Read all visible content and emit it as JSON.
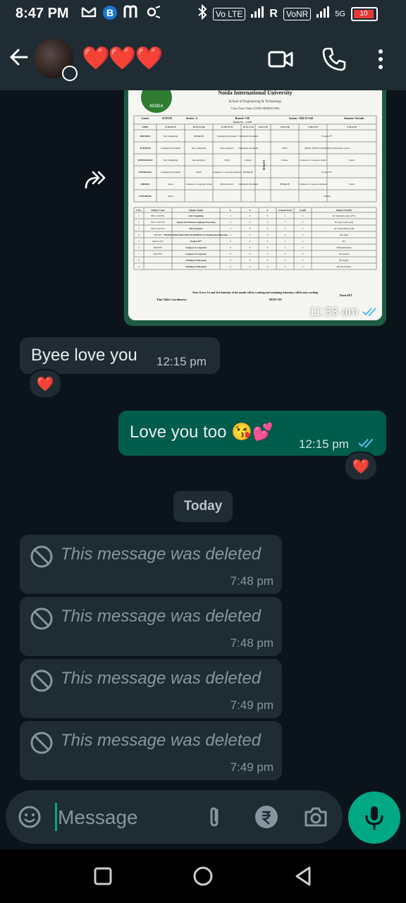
{
  "status_bar": {
    "time": "8:47 PM",
    "left_icons": [
      "gmail-icon",
      "b-icon",
      "m-icon",
      "settings-icon"
    ],
    "volte_label": "Vo LTE",
    "signal1_label": "R",
    "vonr_label": "VoNR",
    "network_label": "5G",
    "battery_label": "10"
  },
  "header": {
    "contact_name": "❤️❤️❤️"
  },
  "chat": {
    "image_message": {
      "time": "11:33 am",
      "document": {
        "university": "Noida International University",
        "school": "School of Engineering & Technology",
        "subtitle": "Class Time Table (ODD SEMESTER)",
        "course": "Course",
        "btech": "B.TECH",
        "section": "Section : A",
        "branch": "Branch: CSE",
        "session": "Session : 2024-25 Odd",
        "semester": "Semester: Seventh",
        "room": "Room No. - N-105",
        "times": [
          "TIME",
          "9:30-10:25",
          "10:25-11:20",
          "11:20-12:15",
          "12:15-1:10",
          "1:10-1:45",
          "1:45-2:40",
          "2:40-3:35",
          "3:35-4:30"
        ],
        "days": [
          {
            "day": "MONDAY",
            "c1": "Soft Computing",
            "c2": "HRD&OB",
            "c3": "Training & Placement",
            "c4": "Training & Placement",
            "c5": "",
            "c6": "Project-II**"
          },
          {
            "day": "TUESDAY",
            "c1": "Training & Placement",
            "c2": "Soft Computing",
            "c3": "Data Analytics",
            "c4": "Training & Placement",
            "c5": "SNLP",
            "c6": "MOOC (NPTEL/SWAYAM) Certification Course"
          },
          {
            "day": "WEDNESDAY",
            "c1": "Soft Computing",
            "c2": "Data Analytics",
            "c3": "SNLP",
            "c4": "Library",
            "c5": "Library",
            "c6": "Compass to Corporate Verbal",
            "c7": "Sports"
          },
          {
            "day": "THURSDAY",
            "c1": "Training & Placement",
            "c2": "SNLP",
            "c3": "Compass to Corporate Aptitude",
            "c4": "HRD&OB",
            "c5": "",
            "c6": "Project-II**"
          },
          {
            "day": "FRIDAY",
            "c1": "Sports",
            "c2": "Compass to Corporate Verbal",
            "c3": "Data Analytics",
            "c4": "Training & Placement",
            "c5": "HRD&OB",
            "c6": "Compass to Corporate Aptitude",
            "c7": "Sports"
          },
          {
            "day": "SATURDAY",
            "c1": "Sports",
            "c6": "Library"
          }
        ],
        "lunch": "LUNCH",
        "subject_headers": [
          "S.No.",
          "Subject Code",
          "Subject Name",
          "L",
          "T",
          "P",
          "Contact hour",
          "Credit",
          "Subject Faculty"
        ],
        "subjects": [
          [
            "1",
            "PEC-CS-D 701",
            "Soft Computing",
            "3",
            "0",
            "0",
            "3",
            "3",
            "Dr. Veerendra yadav (VY)"
          ],
          [
            "2",
            "PEC-CS-D 702",
            "Speech and Natural Language Processing",
            "3",
            "0",
            "0",
            "3",
            "3",
            "Dr. Arpit Tomar (AT)"
          ],
          [
            "3",
            "PEC-CS-D 703",
            "Data Analytics",
            "3",
            "0",
            "0",
            "3",
            "3",
            "Dr. Vimal Bibhu (VB)"
          ],
          [
            "4",
            "OEC002",
            "HUMAN RESOURCE DEVELOPMENT & Organization Behaviour",
            "3",
            "0",
            "0",
            "3",
            "3",
            "Mr. Abhu"
          ],
          [
            "5",
            "PROJ-CS70",
            "Project-II**",
            "0",
            "0",
            "0",
            "3",
            "3",
            "SF1"
          ],
          [
            "6",
            "NIUTP07",
            "Compass to Corporate",
            "0",
            "0",
            "0",
            "3",
            "3",
            "Vibha Khurendra"
          ],
          [
            "7",
            "NIUTP07",
            "Compass to Corporate",
            "0",
            "0",
            "0",
            "3",
            "3",
            "Varu Kumar"
          ],
          [
            "8",
            "",
            "Training & Placement",
            "0",
            "0",
            "0",
            "3",
            "3",
            "Mr Pragya"
          ],
          [
            "9",
            "",
            "Training & Placement",
            "0",
            "0",
            "0",
            "3",
            "3",
            "Mr Pawan Dutta"
          ]
        ],
        "note": "Note: Every 1st and 3rd Saturday of the month will be working and remaining Saturdays will be non-working",
        "coordinator": "Time Table Coordinator:-",
        "hod": "HOD CSE",
        "dean": "Dean-SET"
      }
    },
    "messages": [
      {
        "direction": "incoming",
        "text": "Byee love you",
        "time": "12:15 pm",
        "reaction": "❤️"
      },
      {
        "direction": "outgoing",
        "text": "Love you too 😘💕",
        "time": "12:15 pm",
        "reaction": "❤️"
      }
    ],
    "date_chip": "Today",
    "deleted_messages": [
      {
        "text": "This message was deleted",
        "time": "7:48 pm"
      },
      {
        "text": "This message was deleted",
        "time": "7:48 pm"
      },
      {
        "text": "This message was deleted",
        "time": "7:49 pm"
      },
      {
        "text": "This message was deleted",
        "time": "7:49 pm"
      }
    ]
  },
  "input": {
    "placeholder": "Message"
  },
  "colors": {
    "background": "#0b141a",
    "header": "#1f2c34",
    "outgoing_bubble": "#005c4b",
    "incoming_bubble": "#1f2c34",
    "accent": "#00a884",
    "read_ticks": "#53bdeb"
  }
}
